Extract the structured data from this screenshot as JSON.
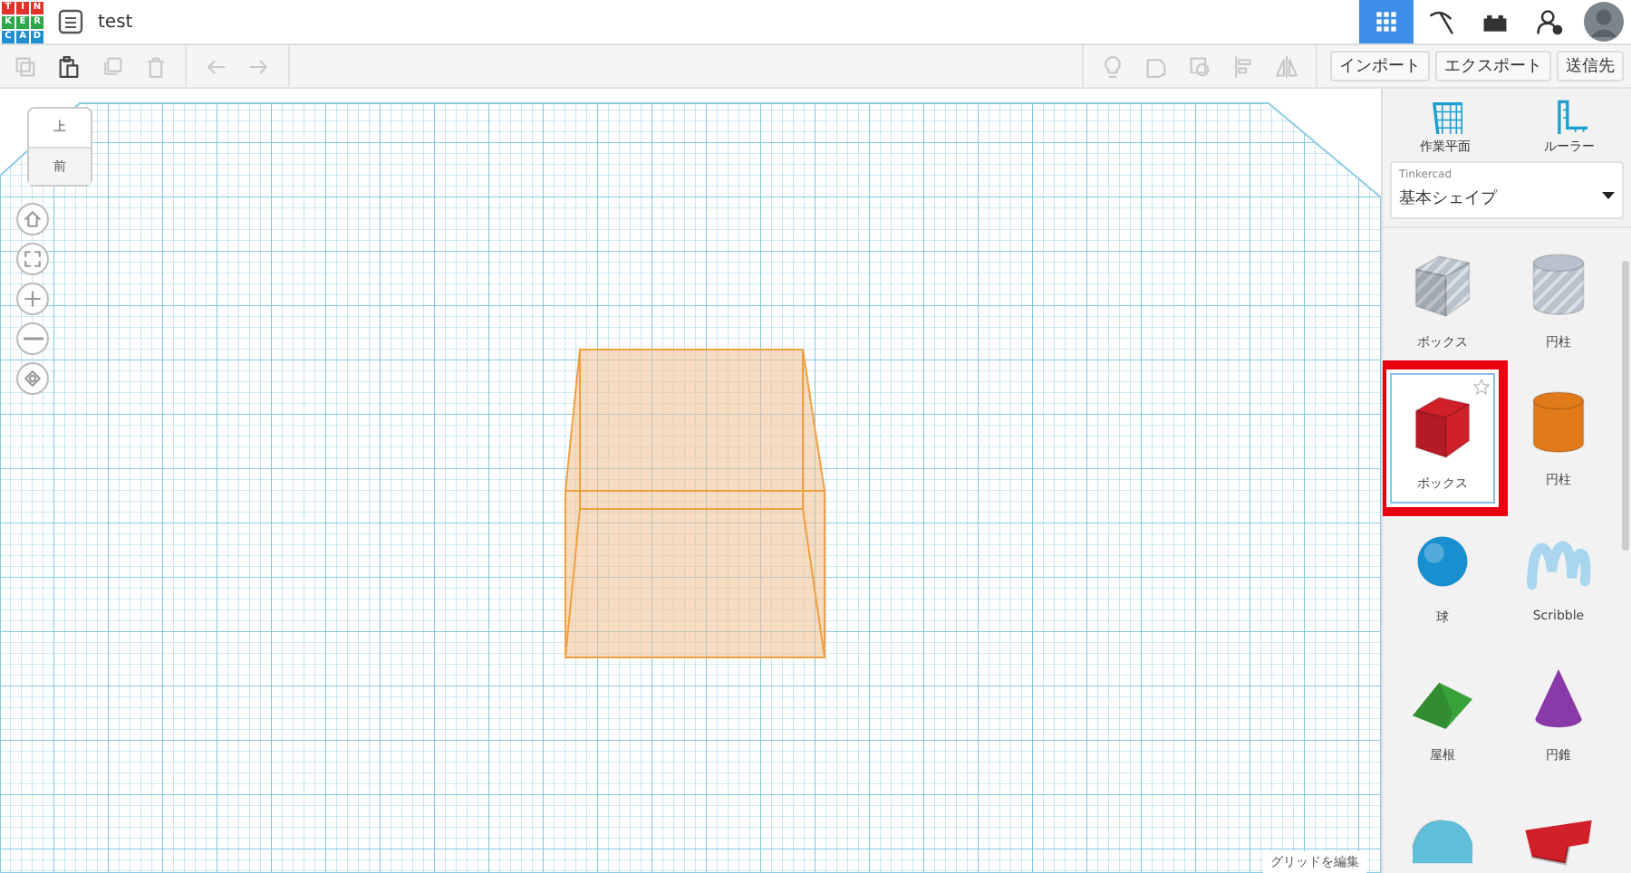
{
  "app": {
    "logo_letters": [
      "T",
      "I",
      "N",
      "K",
      "E",
      "R",
      "C",
      "A",
      "D"
    ],
    "title": "test"
  },
  "top_icons": [
    {
      "kind": "grid",
      "selected": true
    },
    {
      "kind": "pickaxe",
      "selected": false
    },
    {
      "kind": "bricks",
      "selected": false
    },
    {
      "kind": "user-add",
      "selected": false
    },
    {
      "kind": "avatar",
      "selected": false
    }
  ],
  "toolbar_left": [
    {
      "kind": "copy",
      "disabled": true
    },
    {
      "kind": "paste",
      "disabled": false
    },
    {
      "kind": "duplicate",
      "disabled": true
    },
    {
      "kind": "trash",
      "disabled": true
    },
    {
      "kind": "undo",
      "disabled": true
    },
    {
      "kind": "redo",
      "disabled": true
    }
  ],
  "toolbar_right": [
    {
      "kind": "bulb",
      "disabled": true
    },
    {
      "kind": "note",
      "disabled": true
    },
    {
      "kind": "group",
      "disabled": true
    },
    {
      "kind": "align",
      "disabled": true
    },
    {
      "kind": "mirror",
      "disabled": true
    }
  ],
  "actions": [
    "インポート",
    "エクスポート",
    "送信先"
  ],
  "view_cube": {
    "top": "上",
    "front": "前"
  },
  "nav_buttons": [
    {
      "kind": "home"
    },
    {
      "kind": "fit"
    },
    {
      "kind": "plus"
    },
    {
      "kind": "minus"
    },
    {
      "kind": "orbit"
    }
  ],
  "grid_edit": "グリッドを編集",
  "panel": {
    "tools": [
      {
        "kind": "workplane",
        "label": "作業平面"
      },
      {
        "kind": "ruler",
        "label": "ルーラー"
      }
    ],
    "library": {
      "label": "Tinkercad",
      "value": "基本シェイプ"
    },
    "shapes": [
      {
        "kind": "box",
        "label": "ボックス",
        "color": "#b9c2cc",
        "hole": true,
        "selected": false
      },
      {
        "kind": "cylinder",
        "label": "円柱",
        "color": "#b9c2cc",
        "hole": true,
        "selected": false
      },
      {
        "kind": "box",
        "label": "ボックス",
        "color": "#d0202a",
        "selected": true
      },
      {
        "kind": "cylinder",
        "label": "円柱",
        "color": "#e07a1a",
        "selected": false
      },
      {
        "kind": "sphere",
        "label": "球",
        "color": "#1a8fd0",
        "selected": false
      },
      {
        "kind": "scribble",
        "label": "Scribble",
        "color": "#a9d6ee",
        "selected": false
      },
      {
        "kind": "roof",
        "label": "屋根",
        "color": "#3aa23a",
        "selected": false
      },
      {
        "kind": "cone",
        "label": "円錐",
        "color": "#8a3aa8",
        "selected": false
      },
      {
        "kind": "halfcyl",
        "color": "#5fbfd8",
        "selected": false
      },
      {
        "kind": "text3d",
        "color": "#d0202a",
        "selected": false
      }
    ]
  }
}
